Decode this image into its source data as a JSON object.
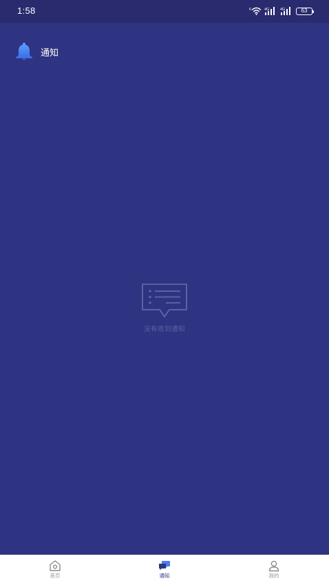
{
  "status_bar": {
    "time": "1:58",
    "battery": "63",
    "network_1": "4G",
    "network_2": "4G"
  },
  "header": {
    "title": "通知",
    "icon": "bell-icon"
  },
  "empty_state": {
    "icon": "message-list-icon",
    "text": "没有收到通知"
  },
  "bottom_nav": {
    "items": [
      {
        "label": "首页",
        "icon": "home-icon",
        "active": false
      },
      {
        "label": "通知",
        "icon": "chat-bubbles-icon",
        "active": true
      },
      {
        "label": "我的",
        "icon": "user-icon",
        "active": false
      }
    ]
  },
  "colors": {
    "background": "#2e3482",
    "status_bar": "#2a2a6e",
    "accent": "#4f7df0",
    "nav_background": "#ffffff"
  }
}
